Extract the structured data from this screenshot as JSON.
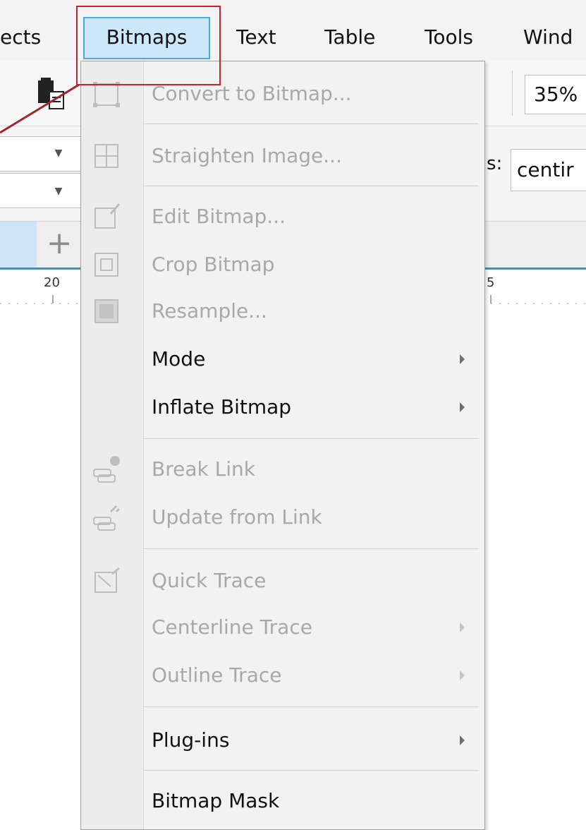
{
  "menubar": {
    "items": [
      {
        "label": "ects"
      },
      {
        "label": "Bitmaps"
      },
      {
        "label": "Text"
      },
      {
        "label": "Table"
      },
      {
        "label": "Tools"
      },
      {
        "label": "Wind"
      }
    ]
  },
  "toolbar": {
    "zoom": "35%"
  },
  "props": {
    "units_label": "s:",
    "units_value": "centir"
  },
  "tabs": {
    "add": "+"
  },
  "ruler": {
    "mark_left": "20",
    "mark_right": "5"
  },
  "menu": {
    "items": [
      {
        "label": "Convert to Bitmap...",
        "u": "",
        "enabled": false,
        "icon": "convert-bitmap-icon"
      },
      {
        "label": "Straighten Image...",
        "enabled": false,
        "icon": "straighten-image-icon"
      },
      {
        "label": "Edit Bitmap...",
        "enabled": false,
        "icon": "edit-bitmap-icon"
      },
      {
        "label": "Crop Bitmap",
        "enabled": false,
        "icon": "crop-bitmap-icon"
      },
      {
        "label": "Resample...",
        "enabled": false,
        "icon": "resample-icon"
      },
      {
        "label": "Mode",
        "enabled": true,
        "submenu": true
      },
      {
        "label": "Inflate Bitmap",
        "enabled": true,
        "submenu": true
      },
      {
        "label": "Break Link",
        "enabled": false,
        "icon": "break-link-icon"
      },
      {
        "label": "Update from Link",
        "enabled": false,
        "icon": "update-link-icon"
      },
      {
        "label": "Quick Trace",
        "enabled": false,
        "icon": "quick-trace-icon"
      },
      {
        "label": "Centerline Trace",
        "enabled": false,
        "submenu": true
      },
      {
        "label": "Outline Trace",
        "enabled": false,
        "submenu": true
      },
      {
        "label": "Plug-ins",
        "enabled": true,
        "submenu": true
      },
      {
        "label": "Bitmap Mask",
        "enabled": true
      }
    ]
  },
  "colors": {
    "highlight": "#c0262d",
    "menubar_hover": "#cde8fb",
    "accent": "#2f95d8"
  }
}
